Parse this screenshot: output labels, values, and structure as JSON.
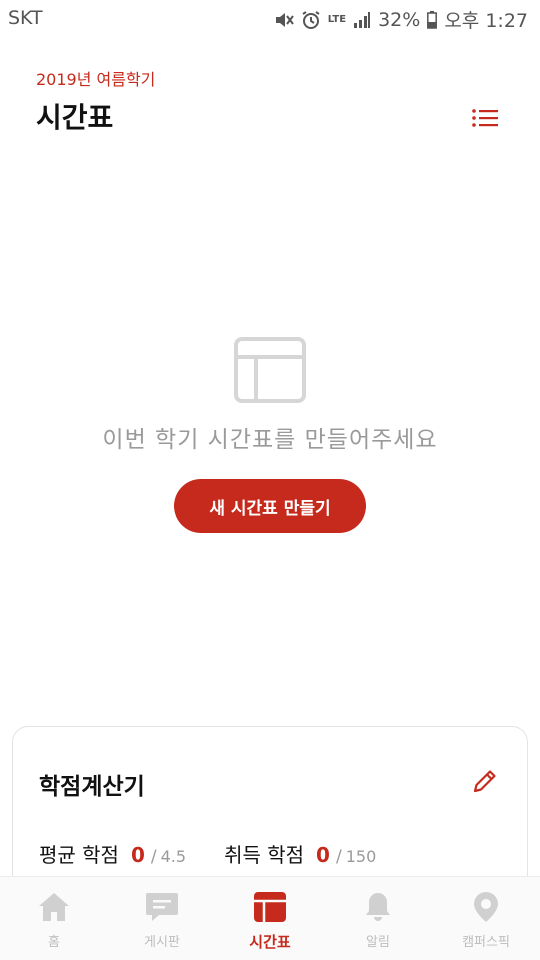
{
  "status_bar": {
    "carrier": "SKT",
    "network": "LTE",
    "battery": "32%",
    "time": "오후 1:27"
  },
  "header": {
    "semester": "2019년 여름학기",
    "title": "시간표",
    "list_icon": "list-icon"
  },
  "empty_state": {
    "icon": "timetable-icon",
    "message": "이번 학기 시간표를 만들어주세요",
    "button_label": "새 시간표 만들기"
  },
  "credit_calculator": {
    "title": "학점계산기",
    "edit_icon": "pencil-icon",
    "gpa": {
      "label": "평균 학점",
      "value": "0",
      "max": "4.5"
    },
    "credits": {
      "label": "취득 학점",
      "value": "0",
      "max": "150"
    }
  },
  "bottom_nav": {
    "items": [
      {
        "label": "홈",
        "icon": "home-icon",
        "active": false
      },
      {
        "label": "게시판",
        "icon": "board-icon",
        "active": false
      },
      {
        "label": "시간표",
        "icon": "timetable-icon",
        "active": true
      },
      {
        "label": "알림",
        "icon": "bell-icon",
        "active": false
      },
      {
        "label": "캠퍼스픽",
        "icon": "campuspick-icon",
        "active": false
      }
    ]
  },
  "colors": {
    "accent": "#c62a1d",
    "muted": "#9a9a9a",
    "inactive_icon": "#d0d0d0"
  }
}
